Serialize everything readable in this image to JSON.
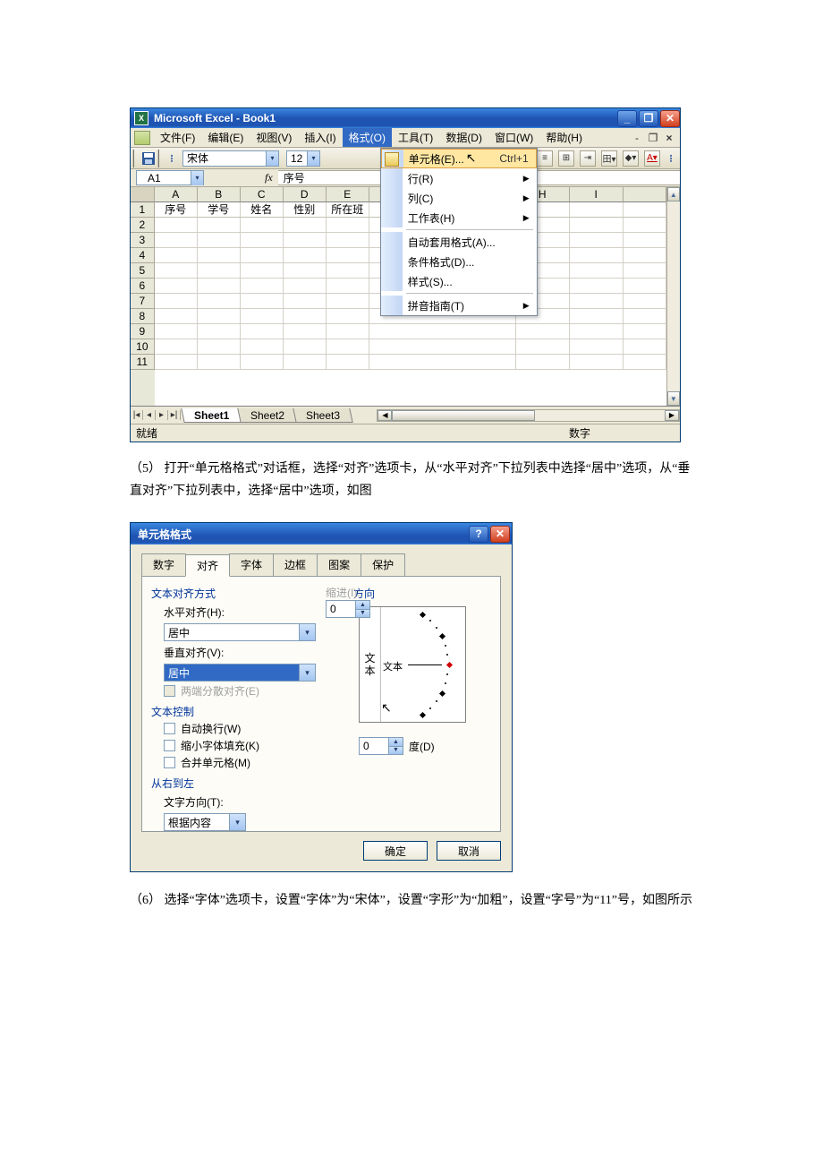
{
  "excel": {
    "title": "Microsoft Excel - Book1",
    "menus": [
      "文件(F)",
      "编辑(E)",
      "视图(V)",
      "插入(I)",
      "格式(O)",
      "工具(T)",
      "数据(D)",
      "窗口(W)",
      "帮助(H)"
    ],
    "font_name": "宋体",
    "font_size": "12",
    "name_box": "A1",
    "fx": "fx",
    "formula_value": "序号",
    "col_headers": [
      "A",
      "B",
      "C",
      "D",
      "E",
      "",
      "",
      "H",
      "I",
      ""
    ],
    "row_numbers": [
      "1",
      "2",
      "3",
      "4",
      "5",
      "6",
      "7",
      "8",
      "9",
      "10",
      "11"
    ],
    "row1": [
      "序号",
      "学号",
      "姓名",
      "性别",
      "所在班"
    ],
    "format_menu": {
      "cells": "单元格(E)...",
      "cells_shortcut": "Ctrl+1",
      "row": "行(R)",
      "column": "列(C)",
      "sheet": "工作表(H)",
      "autoformat": "自动套用格式(A)...",
      "conditional": "条件格式(D)...",
      "style": "样式(S)...",
      "pinyin": "拼音指南(T)"
    },
    "sheet_tabs": [
      "Sheet1",
      "Sheet2",
      "Sheet3"
    ],
    "status_ready": "就绪",
    "status_num": "数字"
  },
  "para5": "（5）    打开“单元格格式”对话框，选择“对齐”选项卡，从“水平对齐”下拉列表中选择“居中”选项，从“垂直对齐”下拉列表中，选择“居中”选项，如图",
  "format_cells": {
    "title": "单元格格式",
    "tabs": [
      "数字",
      "对齐",
      "字体",
      "边框",
      "图案",
      "保护"
    ],
    "grp_text_align": "文本对齐方式",
    "h_align_label": "水平对齐(H):",
    "h_align_value": "居中",
    "indent_label": "缩进(I):",
    "indent_value": "0",
    "v_align_label": "垂直对齐(V):",
    "v_align_value": "居中",
    "justify_distributed": "两端分散对齐(E)",
    "grp_text_control": "文本控制",
    "wrap": "自动换行(W)",
    "shrink": "缩小字体填充(K)",
    "merge": "合并单元格(M)",
    "grp_rtl": "从右到左",
    "text_dir_label": "文字方向(T):",
    "text_dir_value": "根据内容",
    "grp_orientation": "方向",
    "orient_v_text": "文本",
    "orient_h_text": "文本",
    "degrees_value": "0",
    "degrees_label": "度(D)",
    "ok": "确定",
    "cancel": "取消"
  },
  "para6": "（6）    选择“字体”选项卡，设置“字体”为“宋体”，设置“字形”为“加粗”，设置“字号”为“11”号，如图所示"
}
